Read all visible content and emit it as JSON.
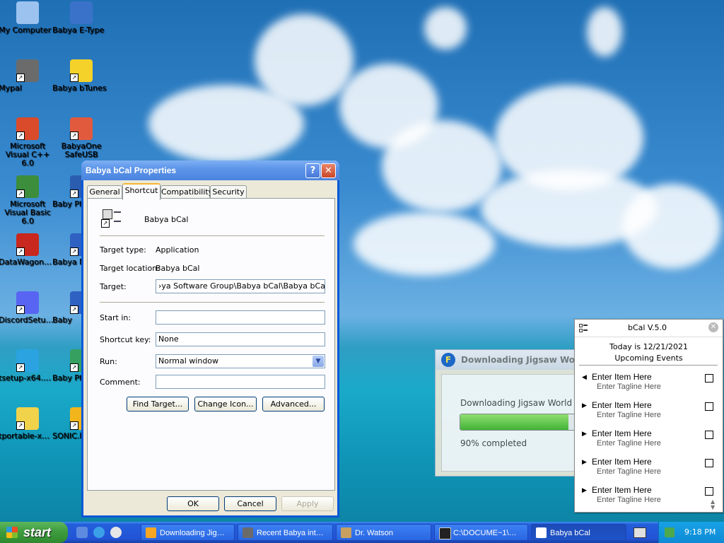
{
  "desktop": {
    "icons": [
      {
        "label": "My Computer",
        "color": "#9cc3ef"
      },
      {
        "label": "Babya E-Type",
        "color": "#3a72c9"
      },
      {
        "label": "Mypal",
        "color": "#6b6b6b"
      },
      {
        "label": "Babya bTunes",
        "color": "#f5d22a"
      },
      {
        "label": "Microsoft Visual C++ 6.0",
        "color": "#d94b2a"
      },
      {
        "label": "BabyaOne SafeUSB",
        "color": "#e25a3d"
      },
      {
        "label": "Microsoft Visual Basic 6.0",
        "color": "#3c8d3c"
      },
      {
        "label": "Baby Phot",
        "color": "#2a5db0"
      },
      {
        "label": "DataWagon…",
        "color": "#c8281d"
      },
      {
        "label": "Babya M",
        "color": "#2f61c2"
      },
      {
        "label": "DiscordSetu…",
        "color": "#5865f2"
      },
      {
        "label": "Baby",
        "color": "#2f61c2"
      },
      {
        "label": "tsetup-x64.…",
        "color": "#2aa3e0"
      },
      {
        "label": "Baby Pho",
        "color": "#36a060"
      },
      {
        "label": "tportable-x…",
        "color": "#f0d24b"
      },
      {
        "label": "SONIC.EXE",
        "color": "#f2b51c"
      }
    ]
  },
  "properties": {
    "title": "Babya bCal Properties",
    "help_label": "?",
    "close_label": "✕",
    "tabs": [
      "General",
      "Shortcut",
      "Compatibility",
      "Security"
    ],
    "app_name": "Babya bCal",
    "target_type_label": "Target type:",
    "target_type_value": "Application",
    "target_location_label": "Target location:",
    "target_location_value": "Babya bCal",
    "target_label": "Target:",
    "target_value": "›ya Software Group\\Babya bCal\\Babya bCal.exe\"",
    "start_in_label": "Start in:",
    "start_in_value": "",
    "shortcut_key_label": "Shortcut key:",
    "shortcut_key_value": "None",
    "run_label": "Run:",
    "run_value": "Normal window",
    "comment_label": "Comment:",
    "comment_value": "",
    "find_target_label": "Find Target...",
    "change_icon_label": "Change Icon...",
    "advanced_label": "Advanced...",
    "ok_label": "OK",
    "cancel_label": "Cancel",
    "apply_label": "Apply"
  },
  "download": {
    "title": "Downloading Jigsaw World (",
    "message": "Downloading Jigsaw World",
    "progress_text": "90% completed",
    "progress": 0.9
  },
  "bcal": {
    "title": "bCal V.5.0",
    "today": "Today is 12/21/2021",
    "upcoming": "Upcoming Events",
    "events": [
      {
        "name": "Enter Item Here",
        "tagline": "Enter Tagline Here"
      },
      {
        "name": "Enter Item Here",
        "tagline": "Enter Tagline Here"
      },
      {
        "name": "Enter Item Here",
        "tagline": "Enter Tagline Here"
      },
      {
        "name": "Enter Item Here",
        "tagline": "Enter Tagline Here"
      },
      {
        "name": "Enter Item Here",
        "tagline": "Enter Tagline Here"
      }
    ]
  },
  "taskbar": {
    "start_label": "start",
    "tasks": [
      {
        "label": "Downloading Jig…",
        "color": "#f5a623"
      },
      {
        "label": "Recent Babya int…",
        "color": "#6b6b6b"
      },
      {
        "label": "Dr. Watson",
        "color": "#c8a060"
      },
      {
        "label": "C:\\DOCUME~1\\…",
        "color": "#222222"
      },
      {
        "label": "Babya bCal",
        "color": "#ffffff"
      }
    ],
    "clock": "9:18 PM"
  }
}
